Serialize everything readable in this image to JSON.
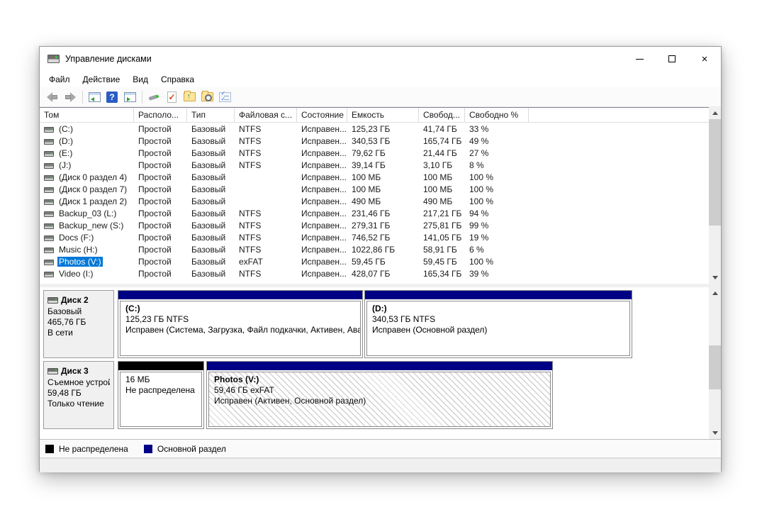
{
  "window": {
    "title": "Управление дисками",
    "controls": {
      "minimize": "minimize",
      "maximize": "maximize",
      "close": "close"
    }
  },
  "menu": {
    "items": [
      "Файл",
      "Действие",
      "Вид",
      "Справка"
    ]
  },
  "toolbar": {
    "icons": [
      "back-icon",
      "forward-icon",
      "console-tree-icon",
      "help-icon",
      "detail-pane-icon",
      "disk-tool-icon",
      "task-check-icon",
      "folder-up-icon",
      "folder-search-icon",
      "checklist-icon"
    ]
  },
  "volume_table": {
    "columns": [
      "Том",
      "Располо...",
      "Тип",
      "Файловая с...",
      "Состояние",
      "Емкость",
      "Свобод...",
      "Свободно %"
    ],
    "rows": [
      {
        "name": "(C:)",
        "layout": "Простой",
        "type": "Базовый",
        "fs": "NTFS",
        "status": "Исправен...",
        "capacity": "125,23 ГБ",
        "free": "41,74 ГБ",
        "free_pct": "33 %",
        "selected": false
      },
      {
        "name": "(D:)",
        "layout": "Простой",
        "type": "Базовый",
        "fs": "NTFS",
        "status": "Исправен...",
        "capacity": "340,53 ГБ",
        "free": "165,74 ГБ",
        "free_pct": "49 %",
        "selected": false
      },
      {
        "name": "(E:)",
        "layout": "Простой",
        "type": "Базовый",
        "fs": "NTFS",
        "status": "Исправен...",
        "capacity": "79,62 ГБ",
        "free": "21,44 ГБ",
        "free_pct": "27 %",
        "selected": false
      },
      {
        "name": "(J:)",
        "layout": "Простой",
        "type": "Базовый",
        "fs": "NTFS",
        "status": "Исправен...",
        "capacity": "39,14 ГБ",
        "free": "3,10 ГБ",
        "free_pct": "8 %",
        "selected": false
      },
      {
        "name": "(Диск 0 раздел 4)",
        "layout": "Простой",
        "type": "Базовый",
        "fs": "",
        "status": "Исправен...",
        "capacity": "100 МБ",
        "free": "100 МБ",
        "free_pct": "100 %",
        "selected": false
      },
      {
        "name": "(Диск 0 раздел 7)",
        "layout": "Простой",
        "type": "Базовый",
        "fs": "",
        "status": "Исправен...",
        "capacity": "100 МБ",
        "free": "100 МБ",
        "free_pct": "100 %",
        "selected": false
      },
      {
        "name": "(Диск 1 раздел 2)",
        "layout": "Простой",
        "type": "Базовый",
        "fs": "",
        "status": "Исправен...",
        "capacity": "490 МБ",
        "free": "490 МБ",
        "free_pct": "100 %",
        "selected": false
      },
      {
        "name": "Backup_03 (L:)",
        "layout": "Простой",
        "type": "Базовый",
        "fs": "NTFS",
        "status": "Исправен...",
        "capacity": "231,46 ГБ",
        "free": "217,21 ГБ",
        "free_pct": "94 %",
        "selected": false
      },
      {
        "name": "Backup_new (S:)",
        "layout": "Простой",
        "type": "Базовый",
        "fs": "NTFS",
        "status": "Исправен...",
        "capacity": "279,31 ГБ",
        "free": "275,81 ГБ",
        "free_pct": "99 %",
        "selected": false
      },
      {
        "name": "Docs (F:)",
        "layout": "Простой",
        "type": "Базовый",
        "fs": "NTFS",
        "status": "Исправен...",
        "capacity": "746,52 ГБ",
        "free": "141,05 ГБ",
        "free_pct": "19 %",
        "selected": false
      },
      {
        "name": "Music (H:)",
        "layout": "Простой",
        "type": "Базовый",
        "fs": "NTFS",
        "status": "Исправен...",
        "capacity": "1022,86 ГБ",
        "free": "58,91 ГБ",
        "free_pct": "6 %",
        "selected": false
      },
      {
        "name": "Photos (V:)",
        "layout": "Простой",
        "type": "Базовый",
        "fs": "exFAT",
        "status": "Исправен...",
        "capacity": "59,45 ГБ",
        "free": "59,45 ГБ",
        "free_pct": "100 %",
        "selected": true
      },
      {
        "name": "Video (I:)",
        "layout": "Простой",
        "type": "Базовый",
        "fs": "NTFS",
        "status": "Исправен...",
        "capacity": "428,07 ГБ",
        "free": "165,34 ГБ",
        "free_pct": "39 %",
        "selected": false
      }
    ]
  },
  "disks": [
    {
      "name": "Диск 2",
      "type": "Базовый",
      "size": "465,76 ГБ",
      "status": "В сети",
      "partitions": [
        {
          "title": "(C:)",
          "line2": "125,23 ГБ NTFS",
          "line3": "Исправен (Система, Загрузка, Файл подкачки, Активен, Авар",
          "kind": "primary"
        },
        {
          "title": "(D:)",
          "line2": "340,53 ГБ NTFS",
          "line3": "Исправен (Основной раздел)",
          "kind": "primary"
        }
      ]
    },
    {
      "name": "Диск 3",
      "type": "Съемное устройство",
      "size": "59,48 ГБ",
      "status": "Только чтение",
      "partitions": [
        {
          "title": "",
          "line2": "16 МБ",
          "line3": "Не распределена",
          "kind": "unallocated"
        },
        {
          "title": "Photos  (V:)",
          "line2": "59,46 ГБ exFAT",
          "line3": "Исправен (Активен, Основной раздел)",
          "kind": "primary-selected"
        }
      ]
    }
  ],
  "legend": {
    "items": [
      {
        "label": "Не распределена",
        "color": "#000000"
      },
      {
        "label": "Основной раздел",
        "color": "#000085"
      }
    ]
  }
}
